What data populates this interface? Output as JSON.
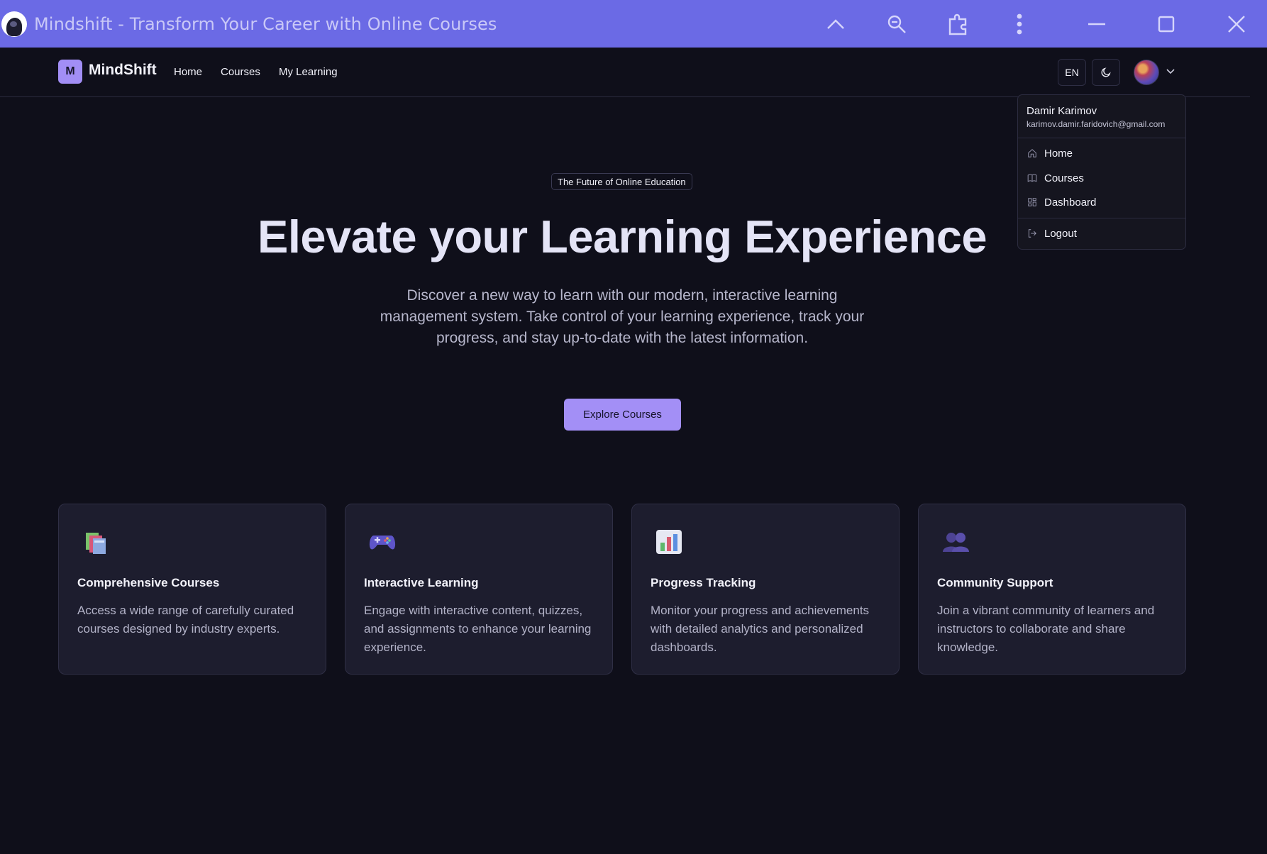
{
  "window": {
    "title": "Mindshift - Transform Your Career with Online Courses",
    "icons": [
      "chevron-up-icon",
      "zoom-icon",
      "extensions-icon",
      "more-vertical-icon",
      "minimize-icon",
      "maximize-icon",
      "close-icon"
    ]
  },
  "navbar": {
    "logo_letter": "M",
    "brand": "MindShift",
    "links": [
      "Home",
      "Courses",
      "My Learning"
    ],
    "language": "EN"
  },
  "user_menu": {
    "name": "Damir Karimov",
    "email": "karimov.damir.faridovich@gmail.com",
    "items": [
      {
        "label": "Home",
        "icon": "home-icon"
      },
      {
        "label": "Courses",
        "icon": "book-icon"
      },
      {
        "label": "Dashboard",
        "icon": "dashboard-icon"
      },
      {
        "label": "Logout",
        "icon": "logout-icon"
      }
    ]
  },
  "hero": {
    "badge": "The Future of Online Education",
    "title": "Elevate your Learning Experience",
    "description": "Discover a new way to learn with our modern, interactive learning management system. Take control of your learning experience, track your progress, and stay up-to-date with the latest information.",
    "cta": "Explore Courses"
  },
  "features": [
    {
      "icon": "books-icon",
      "title": "Comprehensive Courses",
      "text": "Access a wide range of carefully curated courses designed by industry experts."
    },
    {
      "icon": "gamepad-icon",
      "title": "Interactive Learning",
      "text": "Engage with interactive content, quizzes, and assignments to enhance your learning experience."
    },
    {
      "icon": "bar-chart-icon",
      "title": "Progress Tracking",
      "text": "Monitor your progress and achievements with detailed analytics and personalized dashboards."
    },
    {
      "icon": "people-icon",
      "title": "Community Support",
      "text": "Join a vibrant community of learners and instructors to collaborate and share knowledge."
    }
  ],
  "colors": {
    "titlebar": "#6b6ae5",
    "background": "#0f0f1a",
    "accent": "#a38ff6",
    "card": "#1d1d2e"
  }
}
